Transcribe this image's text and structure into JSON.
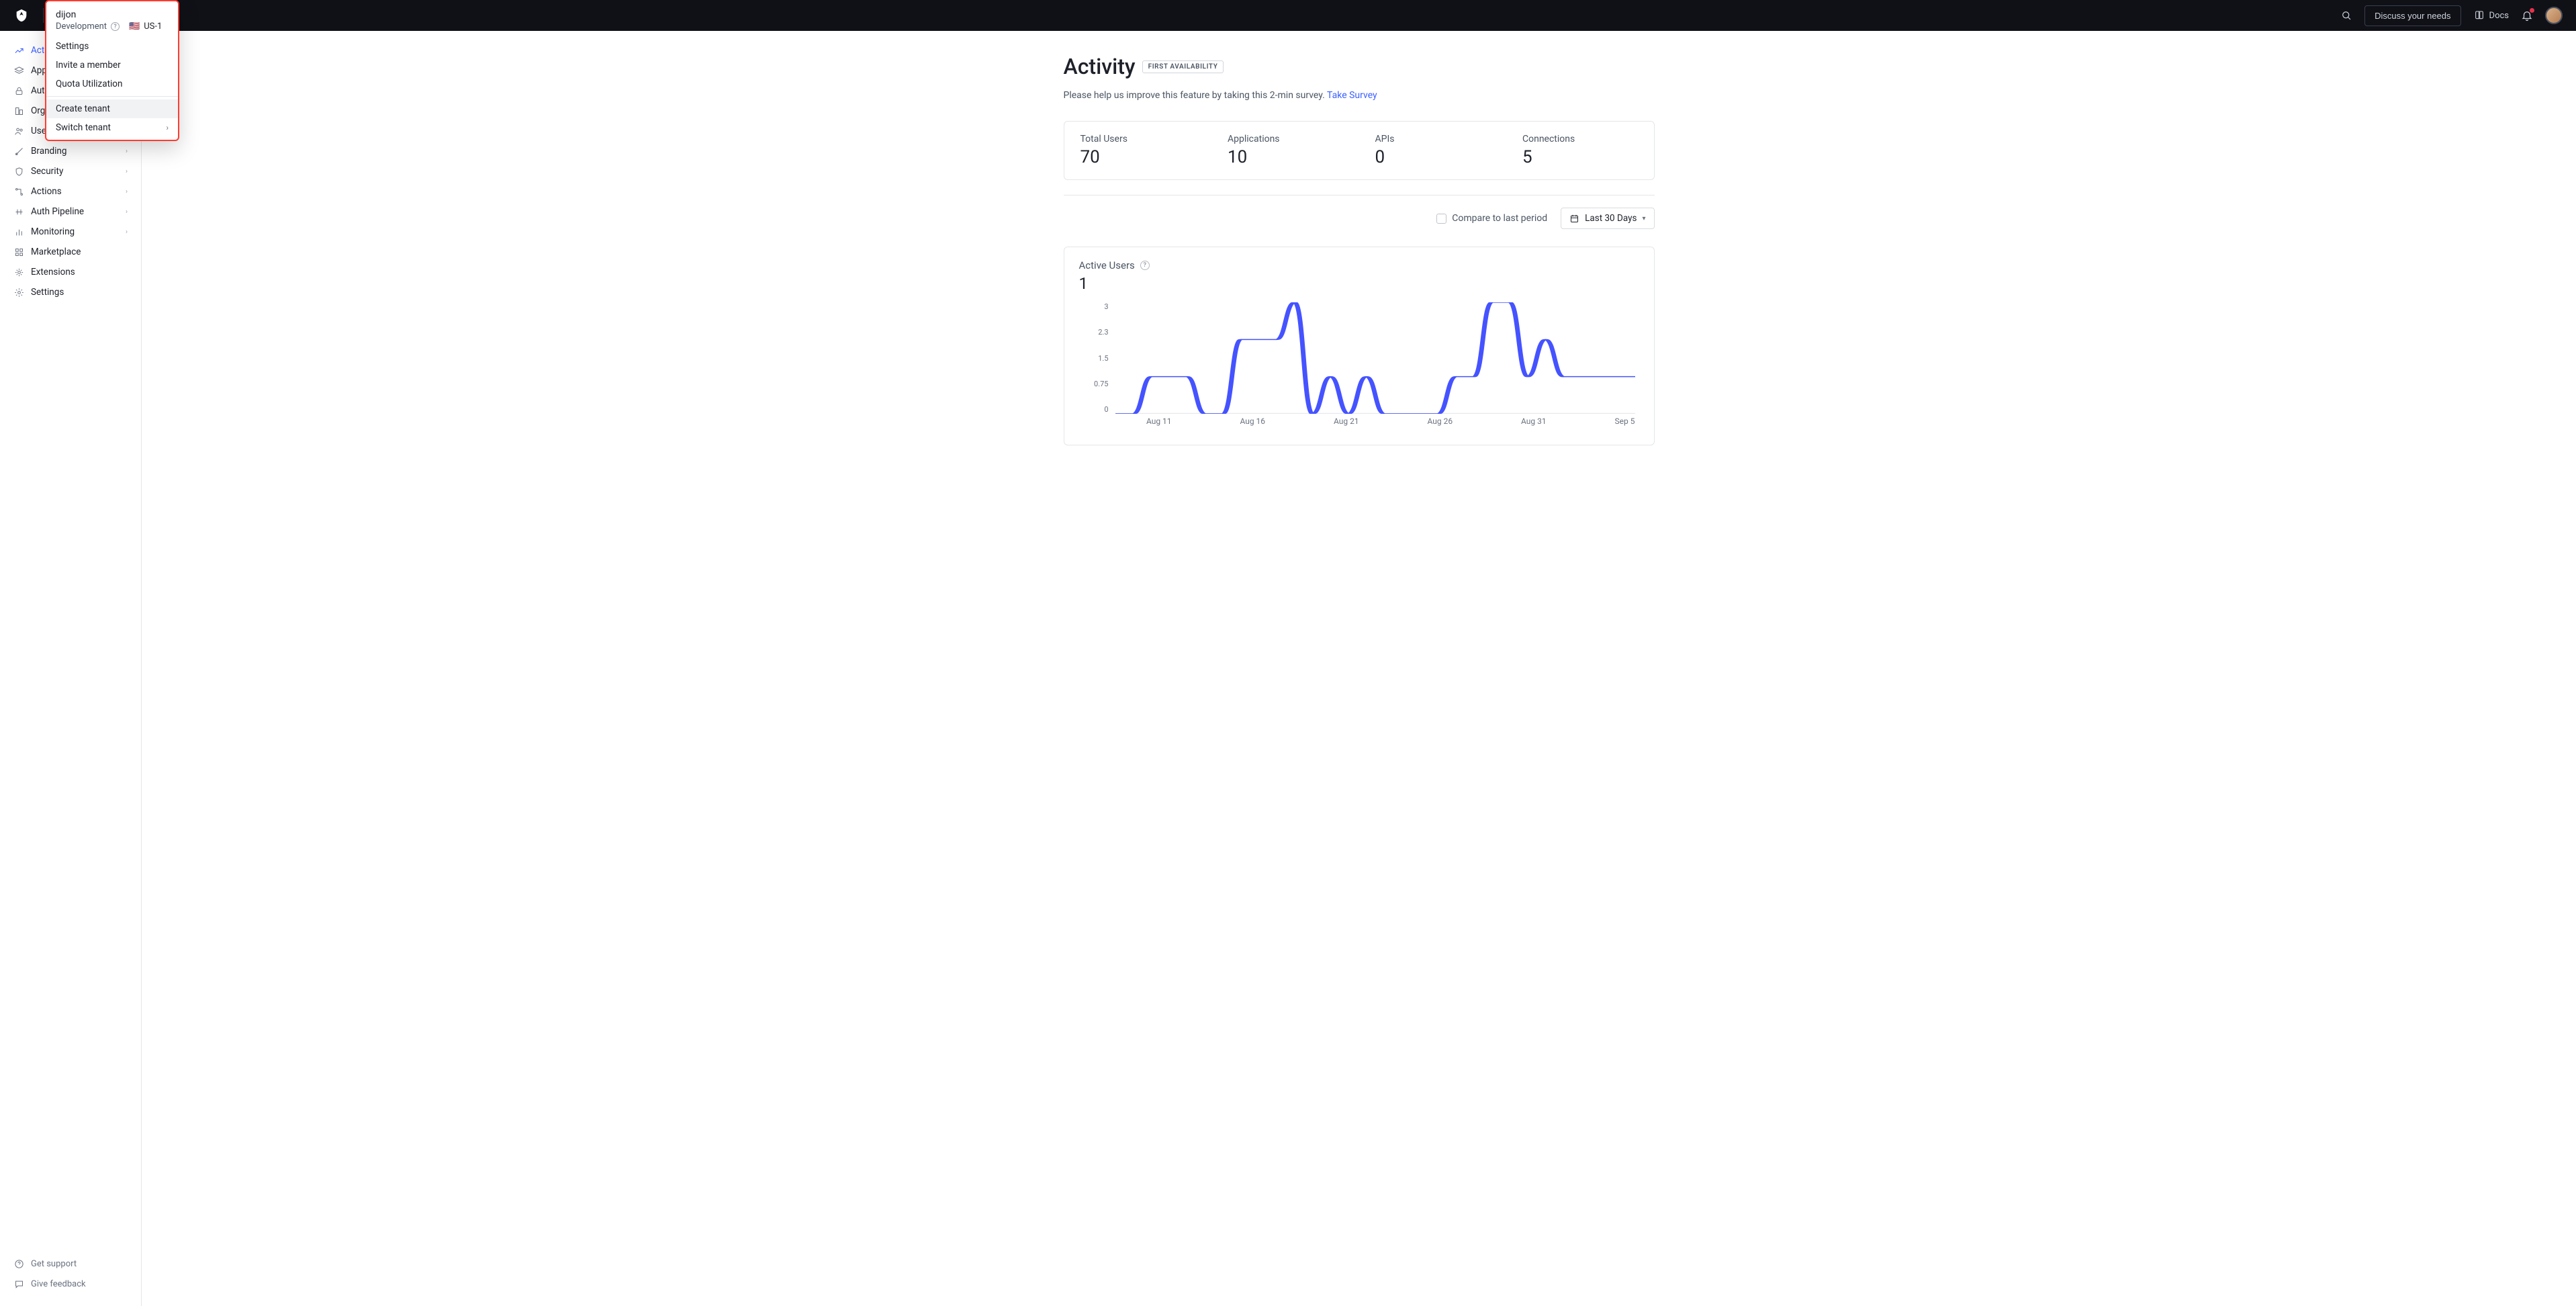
{
  "topbar": {
    "tenant_name": "dijon",
    "tenant_env": "Development",
    "discuss_btn": "Discuss your needs",
    "docs_label": "Docs"
  },
  "dropdown": {
    "tenant_name": "dijon",
    "tenant_env": "Development",
    "region": "US-1",
    "items": {
      "settings": "Settings",
      "invite": "Invite a member",
      "quota": "Quota Utilization",
      "create": "Create tenant",
      "switch": "Switch tenant"
    }
  },
  "sidebar": {
    "items": [
      {
        "label": "Activity"
      },
      {
        "label": "Applications"
      },
      {
        "label": "Authentication"
      },
      {
        "label": "Organizations"
      },
      {
        "label": "User Management"
      },
      {
        "label": "Branding"
      },
      {
        "label": "Security"
      },
      {
        "label": "Actions"
      },
      {
        "label": "Auth Pipeline"
      },
      {
        "label": "Monitoring"
      },
      {
        "label": "Marketplace"
      },
      {
        "label": "Extensions"
      },
      {
        "label": "Settings"
      }
    ],
    "footer": {
      "support": "Get support",
      "feedback": "Give feedback"
    }
  },
  "page": {
    "title": "Activity",
    "badge": "FIRST AVAILABILITY",
    "subtitle_text": "Please help us improve this feature by taking this 2-min survey. ",
    "subtitle_link": "Take Survey"
  },
  "stats": [
    {
      "label": "Total Users",
      "value": "70"
    },
    {
      "label": "Applications",
      "value": "10"
    },
    {
      "label": "APIs",
      "value": "0"
    },
    {
      "label": "Connections",
      "value": "5"
    }
  ],
  "toolbar": {
    "compare_label": "Compare to last period",
    "range_label": "Last 30 Days"
  },
  "chart": {
    "title": "Active Users",
    "big_value": "1",
    "yticks": [
      "3",
      "2.3",
      "1.5",
      "0.75",
      "0"
    ],
    "xticks": [
      "Aug 11",
      "Aug 16",
      "Aug 21",
      "Aug 26",
      "Aug 31",
      "Sep 5"
    ]
  },
  "chart_data": {
    "type": "line",
    "title": "Active Users",
    "ylabel": "",
    "xlabel": "",
    "ylim": [
      0,
      3
    ],
    "series": [
      {
        "name": "Active Users",
        "x": [
          "Aug 7",
          "Aug 8",
          "Aug 9",
          "Aug 10",
          "Aug 11",
          "Aug 12",
          "Aug 13",
          "Aug 14",
          "Aug 15",
          "Aug 16",
          "Aug 17",
          "Aug 18",
          "Aug 19",
          "Aug 20",
          "Aug 21",
          "Aug 22",
          "Aug 23",
          "Aug 24",
          "Aug 25",
          "Aug 26",
          "Aug 27",
          "Aug 28",
          "Aug 29",
          "Aug 30",
          "Aug 31",
          "Sep 1",
          "Sep 2",
          "Sep 3",
          "Sep 4",
          "Sep 5"
        ],
        "values": [
          0,
          0,
          1,
          1,
          1,
          0,
          0,
          2,
          2,
          2,
          3,
          0,
          1,
          0,
          1,
          0,
          0,
          0,
          0,
          1,
          1,
          3,
          3,
          1,
          2,
          1,
          1,
          1,
          1,
          1
        ]
      }
    ]
  }
}
